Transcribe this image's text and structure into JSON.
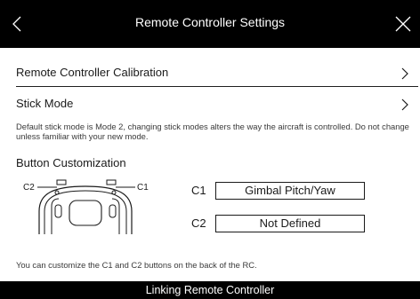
{
  "header": {
    "title": "Remote Controller Settings",
    "back_icon": "chevron-left-icon",
    "close_icon": "close-icon"
  },
  "rows": [
    {
      "label": "Remote Controller Calibration",
      "icon": "chevron-right-icon"
    },
    {
      "label": "Stick Mode",
      "icon": "chevron-right-icon"
    }
  ],
  "stick_mode_description": "Default stick mode is Mode 2, changing stick modes alters the way the aircraft is controlled. Do not change unless familiar with your new mode.",
  "button_customization": {
    "title": "Button Customization",
    "diagram_labels": {
      "c2": "C2",
      "c1": "C1"
    },
    "buttons": [
      {
        "label": "C1",
        "value": "Gimbal Pitch/Yaw"
      },
      {
        "label": "C2",
        "value": "Not Defined"
      }
    ],
    "note": "You can customize the C1 and C2 buttons on the back of the RC."
  },
  "footer": {
    "label": "Linking Remote Controller"
  }
}
